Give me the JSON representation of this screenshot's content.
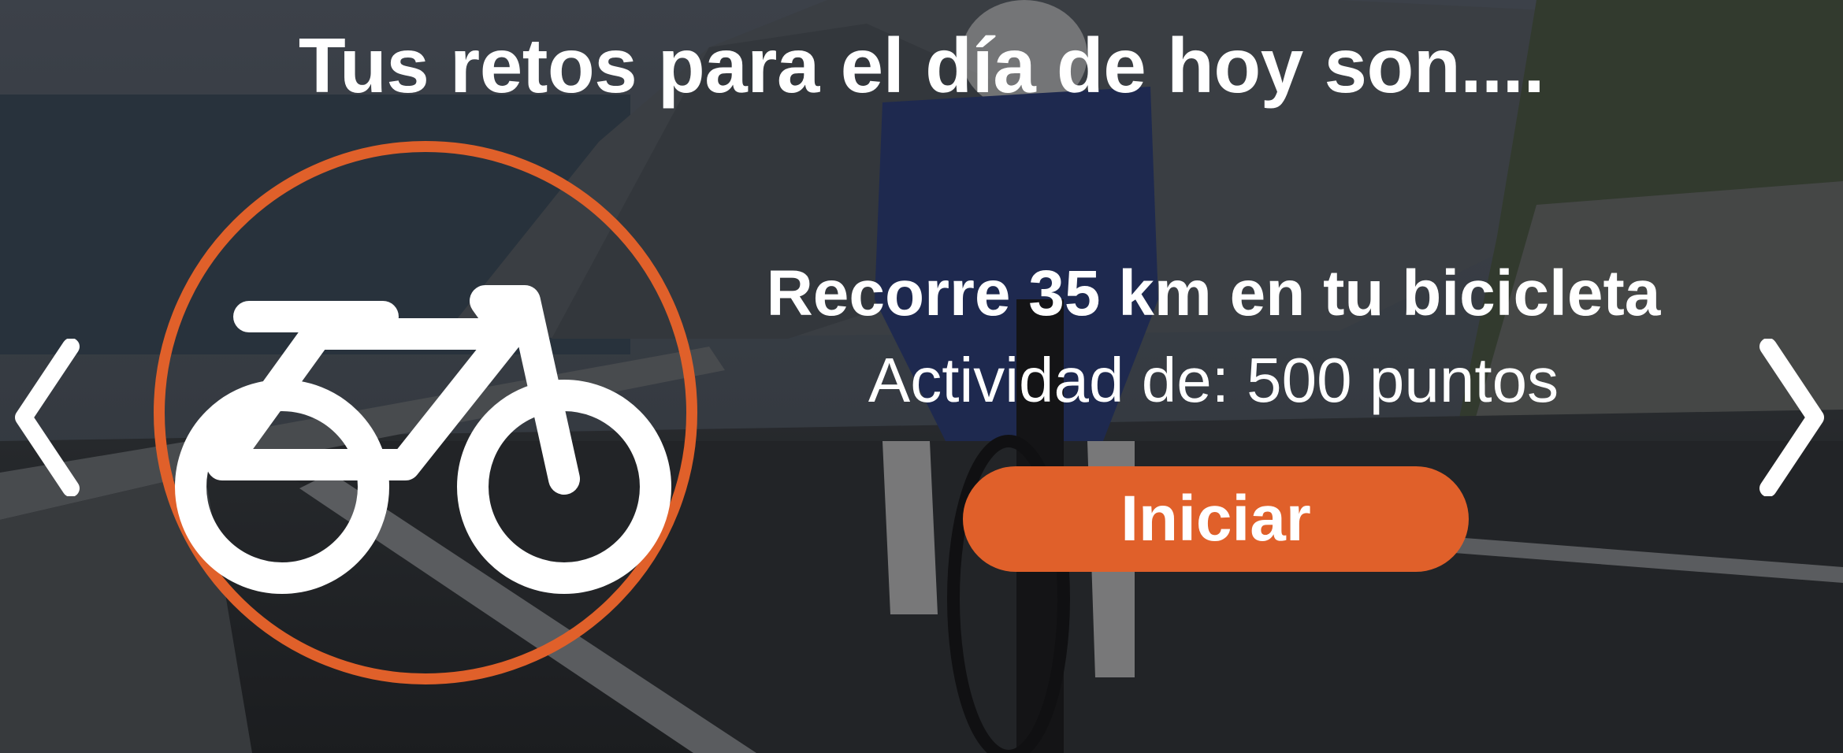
{
  "header": {
    "title": "Tus retos para el día de hoy son...."
  },
  "challenge": {
    "icon": "bicycle-icon",
    "title": "Recorre 35 km en tu bicicleta",
    "points_text": "Actividad de: 500 puntos",
    "start_label": "Iniciar"
  },
  "navigation": {
    "prev_icon": "chevron-left-icon",
    "next_icon": "chevron-right-icon"
  },
  "colors": {
    "accent": "#e0602a",
    "text": "#ffffff"
  }
}
